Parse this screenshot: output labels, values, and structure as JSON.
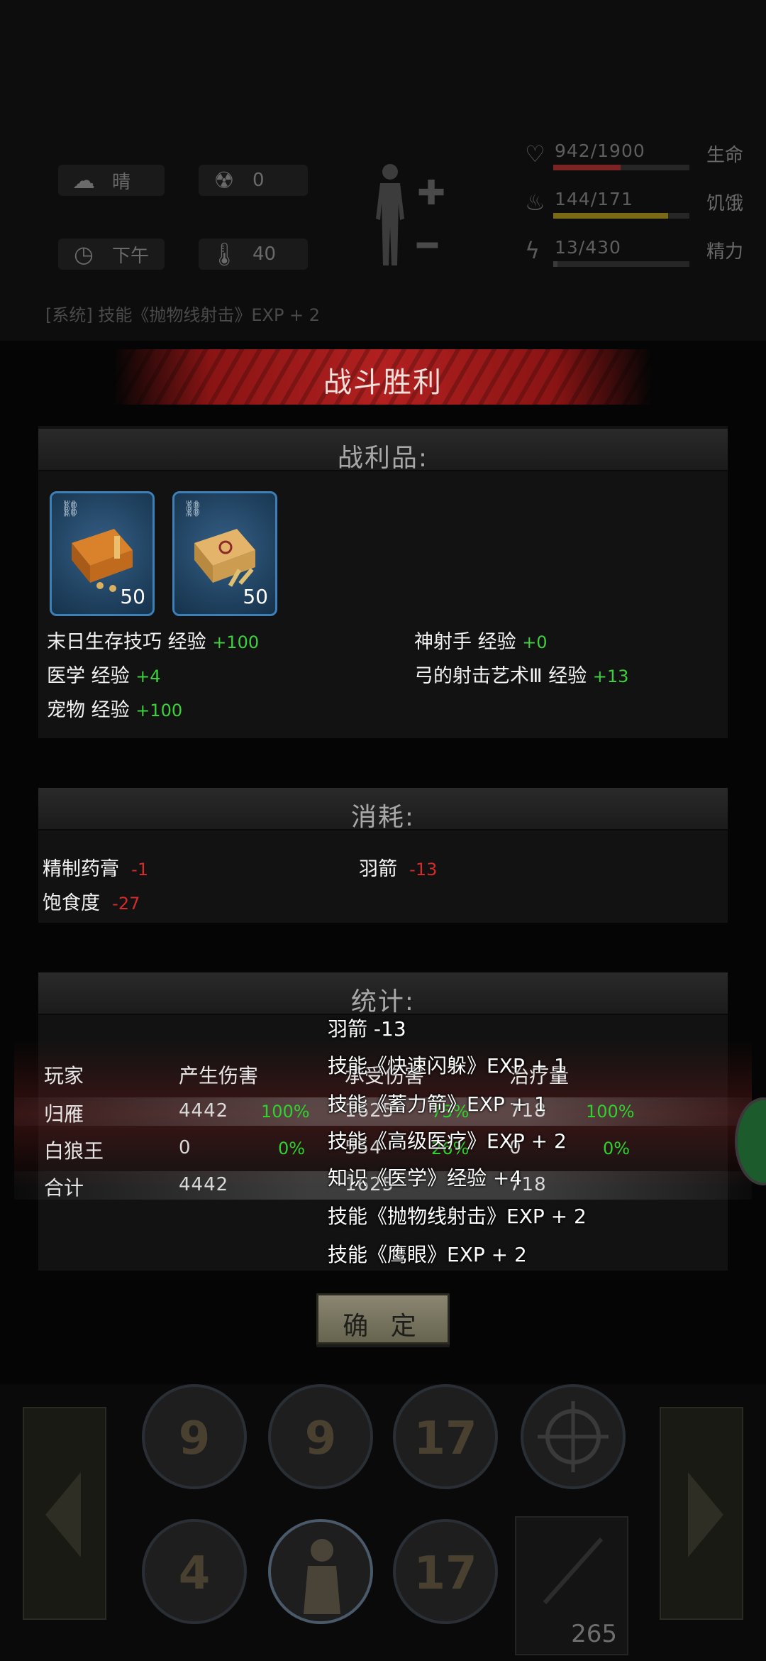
{
  "hud": {
    "weather": "晴",
    "radiation": "0",
    "time_of_day": "下午",
    "temperature": "40",
    "life": {
      "value": "942/1900",
      "label": "生命",
      "fraction": 0.496,
      "color": "#7a2424"
    },
    "hunger": {
      "value": "144/171",
      "label": "饥饿",
      "fraction": 0.842,
      "color": "#7a6a18"
    },
    "energy": {
      "value": "13/430",
      "label": "精力",
      "fraction": 0.03,
      "color": "#3a3a3a"
    },
    "log_line": "[系统] 技能《抛物线射击》EXP + 2"
  },
  "dialog": {
    "title": "战斗胜利",
    "loot_header": "战利品:",
    "loot_items": [
      {
        "icon": "ammo-box-icon",
        "count": "50"
      },
      {
        "icon": "ammo-box-icon",
        "count": "50"
      }
    ],
    "exp_gains": [
      {
        "name": "末日生存技巧 经验",
        "delta": "+100"
      },
      {
        "name": "神射手 经验",
        "delta": "+0"
      },
      {
        "name": "医学 经验",
        "delta": "+4"
      },
      {
        "name": "弓的射击艺术Ⅲ 经验",
        "delta": "+13"
      },
      {
        "name": "宠物 经验",
        "delta": "+100"
      }
    ],
    "consume_header": "消耗:",
    "consumed": [
      {
        "name": "精制药膏",
        "delta": "-1"
      },
      {
        "name": "羽箭",
        "delta": "-13"
      },
      {
        "name": "饱食度",
        "delta": "-27"
      }
    ],
    "stats_header": "统计:",
    "stats_table": {
      "columns": [
        "玩家",
        "产生伤害",
        "承受伤害",
        "治疗量"
      ],
      "rows": [
        {
          "player": "归雁",
          "damage": "4442",
          "damage_pct": "100%",
          "taken": "1625",
          "taken_pct": "75%",
          "heal": "718",
          "heal_pct": "100%"
        },
        {
          "player": "白狼王",
          "damage": "0",
          "damage_pct": "0%",
          "taken": "554",
          "taken_pct": "26%",
          "heal": "0",
          "heal_pct": "0%"
        },
        {
          "player": "合计",
          "damage": "4442",
          "damage_pct": "",
          "taken": "1625",
          "taken_pct": "",
          "heal": "718",
          "heal_pct": ""
        }
      ]
    },
    "overlay_messages": [
      "羽箭 -13",
      "技能《快速闪躲》EXP + 1",
      "技能《蓄力箭》EXP + 1",
      "技能《高级医疗》EXP + 2",
      "知识《医学》经验 +4",
      "技能《抛物线射击》EXP + 2",
      "技能《鹰眼》EXP + 2"
    ],
    "confirm_label": "确 定"
  },
  "skillbar": {
    "skills_top": [
      "9",
      "9",
      "17",
      ""
    ],
    "skills_bottom": [
      "4",
      "",
      "17"
    ],
    "ammo_count": "265"
  }
}
